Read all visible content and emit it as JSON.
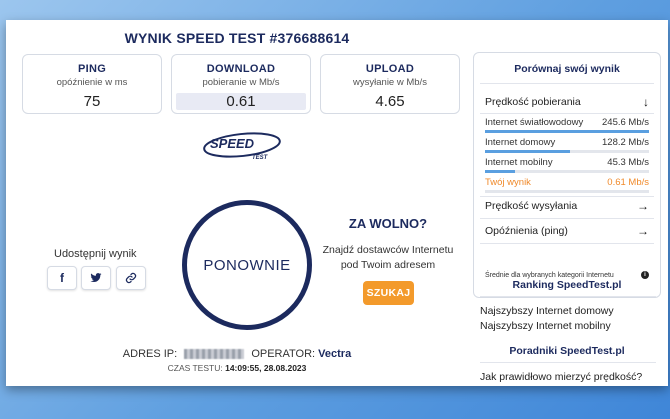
{
  "title": "WYNIK SPEED TEST #376688614",
  "metrics": {
    "ping": {
      "name": "PING",
      "sub": "opóźnienie w ms",
      "value": "75"
    },
    "download": {
      "name": "DOWNLOAD",
      "sub": "pobieranie w Mb/s",
      "value": "0.61"
    },
    "upload": {
      "name": "UPLOAD",
      "sub": "wysyłanie w Mb/s",
      "value": "4.65"
    }
  },
  "logo_text": "SPEED",
  "logo_sub": "TEST",
  "share": {
    "label": "Udostępnij wynik",
    "facebook": "f",
    "twitter": "🐦",
    "link": "🔗"
  },
  "retest_label": "PONOWNIE",
  "slow": {
    "title": "ZA WOLNO?",
    "text": "Znajdź dostawców Internetu pod Twoim adresem",
    "button": "SZUKAJ"
  },
  "info": {
    "ip_label": "ADRES IP:",
    "operator_label": "OPERATOR:",
    "operator": "Vectra",
    "time_label": "CZAS TESTU:",
    "time": "14:09:55, 28.08.2023"
  },
  "compare": {
    "title": "Porównaj swój wynik",
    "download_header": "Prędkość pobierania",
    "rows": [
      {
        "label": "Internet światłowodowy",
        "value": "245.6 Mb/s",
        "fill": 1.0
      },
      {
        "label": "Internet domowy",
        "value": "128.2 Mb/s",
        "fill": 0.52
      },
      {
        "label": "Internet mobilny",
        "value": "45.3 Mb/s",
        "fill": 0.18
      },
      {
        "label": "Twój wynik",
        "value": "0.61 Mb/s",
        "fill": 0.0
      }
    ],
    "upload_header": "Prędkość wysyłania",
    "ping_header": "Opóźnienia (ping)",
    "note": "Średnie dla wybranych kategorii Internetu",
    "info_icon": "i"
  },
  "ranking": {
    "title": "Ranking SpeedTest.pl",
    "links": [
      "Najszybszy Internet domowy",
      "Najszybszy Internet mobilny"
    ]
  },
  "guides": {
    "title": "Poradniki SpeedTest.pl",
    "links": [
      "Jak prawidłowo mierzyć prędkość?"
    ]
  },
  "colors": {
    "navy": "#1c2a5e",
    "orange": "#f39a2b",
    "bar": "#5a9fe0"
  }
}
